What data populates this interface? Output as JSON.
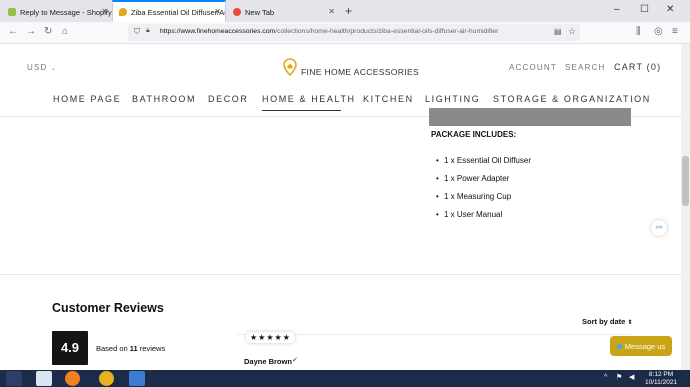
{
  "browser": {
    "tabs": [
      {
        "title": "Reply to Message - Shopify Co",
        "favicon_color": "#95bf47",
        "active": false
      },
      {
        "title": "Ziba Essential Oil Diffuser/Air H",
        "favicon_color": "#e1a91c",
        "active": true
      },
      {
        "title": "New Tab",
        "favicon_color": "#e84b36",
        "active": false
      }
    ],
    "new_tab_symbol": "+",
    "window_controls": [
      "–",
      "☐",
      "✕"
    ],
    "url_domain": "https://www.finehomeaccessories.com",
    "url_path": "/collections/home-health/products/ziba-essential-oils-diffuser-air-humidifier",
    "nav_icons": [
      "back-icon",
      "forward-icon",
      "reload-icon",
      "home-icon"
    ]
  },
  "header": {
    "currency": "USD",
    "logo_text": "FINE HOME ACCESSORIES",
    "account": "ACCOUNT",
    "search": "SEARCH",
    "cart": "CART (0)",
    "accent": "#e1a91c"
  },
  "nav": {
    "items": [
      "HOME PAGE",
      "BATHROOM",
      "DECOR",
      "HOME & HEALTH",
      "KITCHEN",
      "LIGHTING",
      "STORAGE & ORGANIZATION"
    ],
    "active": "HOME & HEALTH"
  },
  "product": {
    "package_title": "PACKAGE INCLUDES:",
    "package_items": [
      "1 x Essential Oil Diffuser",
      "1 x Power Adapter",
      "1 x Measuring Cup",
      "1 x User Manual"
    ]
  },
  "reviews": {
    "title": "Customer Reviews",
    "sort_label": "Sort by date",
    "rating": "4.9",
    "based_on_prefix": "Based on ",
    "count": "11",
    "count_suffix": " reviews",
    "stars": "★★★★★",
    "reviewer": "Dayne Brown",
    "verified_symbol": "✔"
  },
  "chat": {
    "label": "Message us",
    "color": "#c9a516"
  },
  "taskbar": {
    "time": "8:12 PM",
    "date": "10/11/2021"
  }
}
